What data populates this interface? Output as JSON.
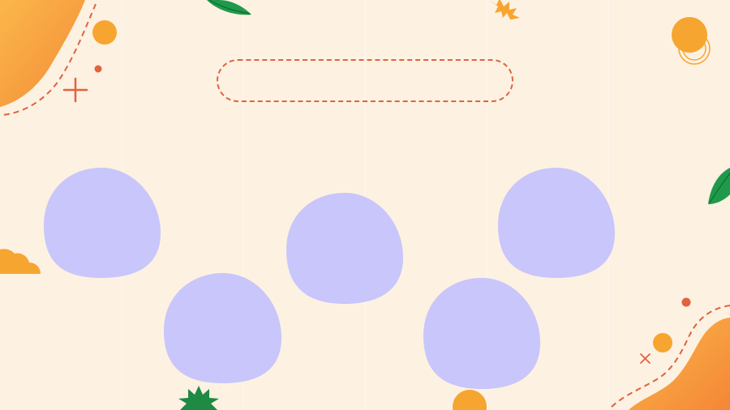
{
  "slide": {
    "title_text": "",
    "background_color": "#fdf1e2"
  },
  "palette": {
    "accent_orange": "#f7a531",
    "accent_red": "#e0633e",
    "blob_lavender": "#c8c6fb",
    "leaf_green": "#1f9a4b",
    "star_green": "#1e8a43"
  },
  "decorations": {
    "blob_count": 5,
    "icons": [
      "leaf-icon",
      "sun-burst-icon",
      "plus-icon",
      "cross-icon",
      "star-burst-icon",
      "cloud-icon",
      "circle-icon"
    ]
  }
}
